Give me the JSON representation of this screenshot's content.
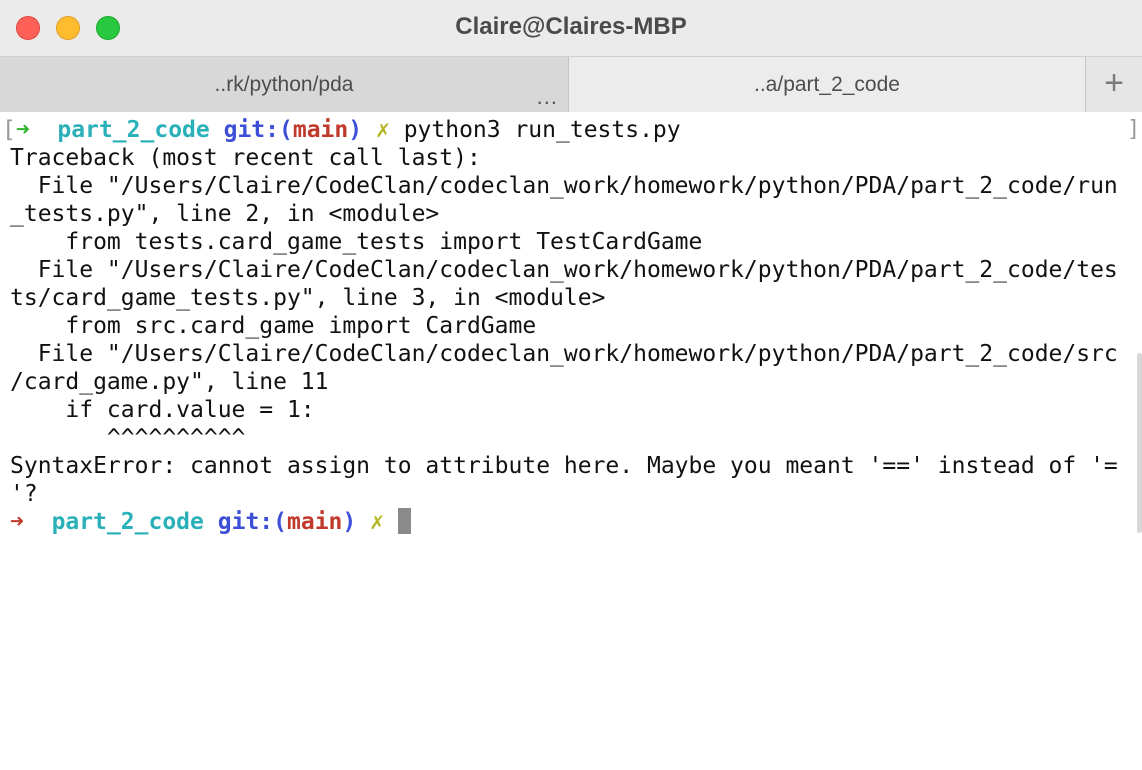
{
  "window": {
    "title": "Claire@Claires-MBP"
  },
  "tabs": [
    {
      "label": "..rk/python/pda",
      "active": false,
      "menu_glyph": "..."
    },
    {
      "label": "..a/part_2_code",
      "active": true
    }
  ],
  "new_tab_glyph": "+",
  "prompt1": {
    "open_bracket": "[",
    "arrow": "➜",
    "dir": "part_2_code",
    "git": "git:(",
    "branch": "main",
    "git_close": ")",
    "dirty": "✗",
    "command": "python3 run_tests.py",
    "close_bracket": "]"
  },
  "output": [
    "Traceback (most recent call last):",
    "  File \"/Users/Claire/CodeClan/codeclan_work/homework/python/PDA/part_2_code/run",
    "_tests.py\", line 2, in <module>",
    "    from tests.card_game_tests import TestCardGame",
    "  File \"/Users/Claire/CodeClan/codeclan_work/homework/python/PDA/part_2_code/tes",
    "ts/card_game_tests.py\", line 3, in <module>",
    "    from src.card_game import CardGame",
    "  File \"/Users/Claire/CodeClan/codeclan_work/homework/python/PDA/part_2_code/src",
    "/card_game.py\", line 11",
    "    if card.value = 1:",
    "       ^^^^^^^^^^",
    "SyntaxError: cannot assign to attribute here. Maybe you meant '==' instead of '=",
    "'?"
  ],
  "prompt2": {
    "arrow": "➜",
    "dir": "part_2_code",
    "git": "git:(",
    "branch": "main",
    "git_close": ")",
    "dirty": "✗"
  },
  "colors": {
    "prompt_ok": "#2fb52f",
    "prompt_err": "#c0392b",
    "dir": "#2ab0b8",
    "git": "#3d4fd6",
    "branch": "#c0392b",
    "dirty": "#b4b41f"
  }
}
